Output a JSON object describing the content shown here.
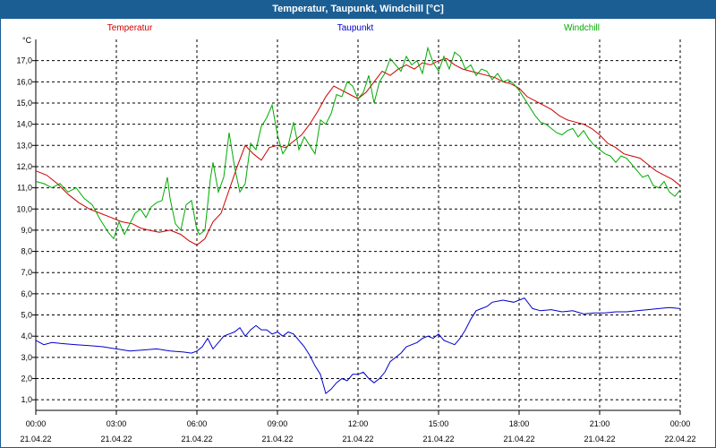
{
  "chart_data": {
    "type": "line",
    "title": "Temperatur, Taupunkt, Windchill [°C]",
    "yunit": "°C",
    "ylim": [
      0.5,
      18.0
    ],
    "yticks": [
      "1,0",
      "2,0",
      "3,0",
      "4,0",
      "5,0",
      "6,0",
      "7,0",
      "8,0",
      "9,0",
      "10,0",
      "11,0",
      "12,0",
      "13,0",
      "14,0",
      "15,0",
      "16,0",
      "17,0"
    ],
    "xlim": [
      0,
      24
    ],
    "xticks": [
      {
        "time": "00:00",
        "date": "21.04.22"
      },
      {
        "time": "03:00",
        "date": "21.04.22"
      },
      {
        "time": "06:00",
        "date": "21.04.22"
      },
      {
        "time": "09:00",
        "date": "21.04.22"
      },
      {
        "time": "12:00",
        "date": "21.04.22"
      },
      {
        "time": "15:00",
        "date": "21.04.22"
      },
      {
        "time": "18:00",
        "date": "21.04.22"
      },
      {
        "time": "21:00",
        "date": "21.04.22"
      },
      {
        "time": "00:00",
        "date": "22.04.22"
      }
    ],
    "grid": true,
    "legend_placement": "top",
    "series": [
      {
        "name": "Temperatur",
        "color": "#cc0000",
        "points": [
          [
            0,
            11.8
          ],
          [
            0.4,
            11.6
          ],
          [
            0.8,
            11.2
          ],
          [
            1.2,
            10.7
          ],
          [
            1.6,
            10.3
          ],
          [
            2.0,
            10.0
          ],
          [
            2.4,
            9.8
          ],
          [
            2.8,
            9.6
          ],
          [
            3.2,
            9.4
          ],
          [
            3.6,
            9.3
          ],
          [
            3.9,
            9.1
          ],
          [
            4.2,
            9.0
          ],
          [
            4.6,
            8.9
          ],
          [
            5.0,
            9.0
          ],
          [
            5.4,
            8.8
          ],
          [
            5.7,
            8.5
          ],
          [
            6.0,
            8.3
          ],
          [
            6.3,
            8.6
          ],
          [
            6.6,
            9.4
          ],
          [
            6.9,
            9.8
          ],
          [
            7.2,
            10.9
          ],
          [
            7.5,
            12.0
          ],
          [
            7.8,
            13.0
          ],
          [
            8.1,
            12.6
          ],
          [
            8.4,
            12.3
          ],
          [
            8.7,
            12.9
          ],
          [
            9.0,
            13.0
          ],
          [
            9.3,
            12.9
          ],
          [
            9.6,
            13.2
          ],
          [
            9.9,
            13.5
          ],
          [
            10.2,
            14.0
          ],
          [
            10.5,
            14.6
          ],
          [
            10.8,
            15.3
          ],
          [
            11.1,
            15.8
          ],
          [
            11.4,
            15.6
          ],
          [
            11.7,
            15.4
          ],
          [
            12.0,
            15.2
          ],
          [
            12.3,
            15.5
          ],
          [
            12.6,
            16.0
          ],
          [
            12.9,
            16.5
          ],
          [
            13.2,
            16.3
          ],
          [
            13.5,
            16.6
          ],
          [
            13.8,
            16.8
          ],
          [
            14.1,
            16.6
          ],
          [
            14.4,
            16.9
          ],
          [
            14.7,
            16.8
          ],
          [
            15.0,
            17.0
          ],
          [
            15.3,
            17.1
          ],
          [
            15.6,
            16.8
          ],
          [
            15.9,
            16.6
          ],
          [
            16.2,
            16.5
          ],
          [
            16.5,
            16.4
          ],
          [
            16.8,
            16.3
          ],
          [
            17.1,
            16.2
          ],
          [
            17.4,
            16.0
          ],
          [
            17.7,
            15.9
          ],
          [
            18.0,
            15.7
          ],
          [
            18.3,
            15.3
          ],
          [
            18.6,
            15.1
          ],
          [
            18.9,
            14.9
          ],
          [
            19.2,
            14.7
          ],
          [
            19.5,
            14.4
          ],
          [
            19.8,
            14.2
          ],
          [
            20.1,
            14.1
          ],
          [
            20.4,
            14.0
          ],
          [
            20.7,
            13.8
          ],
          [
            21.0,
            13.5
          ],
          [
            21.3,
            13.1
          ],
          [
            21.6,
            12.9
          ],
          [
            21.9,
            12.6
          ],
          [
            22.2,
            12.5
          ],
          [
            22.5,
            12.4
          ],
          [
            22.8,
            12.1
          ],
          [
            23.1,
            11.8
          ],
          [
            23.4,
            11.6
          ],
          [
            23.7,
            11.4
          ],
          [
            24.0,
            11.1
          ]
        ]
      },
      {
        "name": "Taupunkt",
        "color": "#0000cc",
        "points": [
          [
            0,
            3.8
          ],
          [
            0.3,
            3.6
          ],
          [
            0.6,
            3.7
          ],
          [
            1.0,
            3.65
          ],
          [
            1.5,
            3.6
          ],
          [
            2.0,
            3.55
          ],
          [
            2.5,
            3.5
          ],
          [
            3.0,
            3.4
          ],
          [
            3.5,
            3.3
          ],
          [
            4.0,
            3.35
          ],
          [
            4.5,
            3.4
          ],
          [
            5.0,
            3.3
          ],
          [
            5.5,
            3.25
          ],
          [
            5.8,
            3.2
          ],
          [
            6.0,
            3.3
          ],
          [
            6.2,
            3.5
          ],
          [
            6.4,
            3.9
          ],
          [
            6.6,
            3.4
          ],
          [
            6.8,
            3.7
          ],
          [
            7.0,
            4.0
          ],
          [
            7.2,
            4.1
          ],
          [
            7.4,
            4.2
          ],
          [
            7.6,
            4.4
          ],
          [
            7.8,
            4.0
          ],
          [
            8.0,
            4.3
          ],
          [
            8.2,
            4.5
          ],
          [
            8.4,
            4.3
          ],
          [
            8.6,
            4.3
          ],
          [
            8.8,
            4.1
          ],
          [
            9.0,
            4.2
          ],
          [
            9.2,
            4.0
          ],
          [
            9.4,
            4.2
          ],
          [
            9.6,
            4.1
          ],
          [
            9.8,
            3.8
          ],
          [
            10.0,
            3.5
          ],
          [
            10.2,
            3.1
          ],
          [
            10.4,
            2.6
          ],
          [
            10.6,
            2.2
          ],
          [
            10.8,
            1.3
          ],
          [
            11.0,
            1.5
          ],
          [
            11.2,
            1.8
          ],
          [
            11.4,
            2.0
          ],
          [
            11.6,
            1.9
          ],
          [
            11.8,
            2.2
          ],
          [
            12.0,
            2.2
          ],
          [
            12.2,
            2.3
          ],
          [
            12.4,
            2.0
          ],
          [
            12.6,
            1.8
          ],
          [
            12.8,
            2.0
          ],
          [
            13.0,
            2.3
          ],
          [
            13.2,
            2.8
          ],
          [
            13.4,
            3.0
          ],
          [
            13.6,
            3.2
          ],
          [
            13.8,
            3.5
          ],
          [
            14.0,
            3.6
          ],
          [
            14.2,
            3.7
          ],
          [
            14.4,
            3.9
          ],
          [
            14.6,
            4.0
          ],
          [
            14.8,
            3.9
          ],
          [
            15.0,
            4.1
          ],
          [
            15.2,
            3.8
          ],
          [
            15.4,
            3.7
          ],
          [
            15.6,
            3.6
          ],
          [
            15.8,
            3.9
          ],
          [
            16.0,
            4.3
          ],
          [
            16.2,
            4.8
          ],
          [
            16.4,
            5.2
          ],
          [
            16.6,
            5.3
          ],
          [
            16.8,
            5.4
          ],
          [
            17.0,
            5.6
          ],
          [
            17.4,
            5.7
          ],
          [
            17.8,
            5.6
          ],
          [
            18.2,
            5.8
          ],
          [
            18.5,
            5.3
          ],
          [
            18.8,
            5.2
          ],
          [
            19.2,
            5.25
          ],
          [
            19.6,
            5.15
          ],
          [
            20.0,
            5.2
          ],
          [
            20.4,
            5.05
          ],
          [
            20.8,
            5.1
          ],
          [
            21.2,
            5.1
          ],
          [
            21.6,
            5.15
          ],
          [
            22.0,
            5.15
          ],
          [
            22.4,
            5.2
          ],
          [
            22.8,
            5.25
          ],
          [
            23.2,
            5.3
          ],
          [
            23.6,
            5.35
          ],
          [
            24.0,
            5.3
          ]
        ]
      },
      {
        "name": "Windchill",
        "color": "#00aa00",
        "points": [
          [
            0,
            11.3
          ],
          [
            0.3,
            11.2
          ],
          [
            0.6,
            11.0
          ],
          [
            0.9,
            11.2
          ],
          [
            1.2,
            10.8
          ],
          [
            1.5,
            11.0
          ],
          [
            1.8,
            10.5
          ],
          [
            2.1,
            10.2
          ],
          [
            2.4,
            9.5
          ],
          [
            2.7,
            8.9
          ],
          [
            2.9,
            8.6
          ],
          [
            3.1,
            9.4
          ],
          [
            3.3,
            8.8
          ],
          [
            3.5,
            9.3
          ],
          [
            3.7,
            9.8
          ],
          [
            3.9,
            10.0
          ],
          [
            4.1,
            9.6
          ],
          [
            4.3,
            10.1
          ],
          [
            4.5,
            10.3
          ],
          [
            4.7,
            10.4
          ],
          [
            4.9,
            11.5
          ],
          [
            5.0,
            10.5
          ],
          [
            5.2,
            9.3
          ],
          [
            5.4,
            9.0
          ],
          [
            5.6,
            10.2
          ],
          [
            5.8,
            10.4
          ],
          [
            6.0,
            9.0
          ],
          [
            6.1,
            8.8
          ],
          [
            6.3,
            9.0
          ],
          [
            6.5,
            11.4
          ],
          [
            6.6,
            12.2
          ],
          [
            6.8,
            10.8
          ],
          [
            7.0,
            11.5
          ],
          [
            7.2,
            13.6
          ],
          [
            7.4,
            12.0
          ],
          [
            7.6,
            10.8
          ],
          [
            7.8,
            11.2
          ],
          [
            8.0,
            13.1
          ],
          [
            8.2,
            12.8
          ],
          [
            8.4,
            13.9
          ],
          [
            8.6,
            14.3
          ],
          [
            8.8,
            14.9
          ],
          [
            9.0,
            13.5
          ],
          [
            9.2,
            12.6
          ],
          [
            9.4,
            13.0
          ],
          [
            9.6,
            14.1
          ],
          [
            9.8,
            12.8
          ],
          [
            10.0,
            13.4
          ],
          [
            10.2,
            13.0
          ],
          [
            10.4,
            12.6
          ],
          [
            10.6,
            14.2
          ],
          [
            10.8,
            14.0
          ],
          [
            11.0,
            14.5
          ],
          [
            11.2,
            15.4
          ],
          [
            11.4,
            15.3
          ],
          [
            11.6,
            16.0
          ],
          [
            11.8,
            15.8
          ],
          [
            12.0,
            15.2
          ],
          [
            12.2,
            15.5
          ],
          [
            12.4,
            16.3
          ],
          [
            12.6,
            15.0
          ],
          [
            12.8,
            16.0
          ],
          [
            13.0,
            16.4
          ],
          [
            13.2,
            17.1
          ],
          [
            13.4,
            16.8
          ],
          [
            13.6,
            16.5
          ],
          [
            13.8,
            17.2
          ],
          [
            14.0,
            16.8
          ],
          [
            14.2,
            17.0
          ],
          [
            14.4,
            16.4
          ],
          [
            14.6,
            17.6
          ],
          [
            14.8,
            16.9
          ],
          [
            15.0,
            16.5
          ],
          [
            15.2,
            17.2
          ],
          [
            15.4,
            16.6
          ],
          [
            15.6,
            17.4
          ],
          [
            15.8,
            17.2
          ],
          [
            16.0,
            16.6
          ],
          [
            16.2,
            16.8
          ],
          [
            16.4,
            16.3
          ],
          [
            16.6,
            16.6
          ],
          [
            16.8,
            16.5
          ],
          [
            17.0,
            16.1
          ],
          [
            17.2,
            16.4
          ],
          [
            17.4,
            16.0
          ],
          [
            17.6,
            16.1
          ],
          [
            17.8,
            15.9
          ],
          [
            18.0,
            15.6
          ],
          [
            18.2,
            15.2
          ],
          [
            18.4,
            14.8
          ],
          [
            18.6,
            14.4
          ],
          [
            18.8,
            14.1
          ],
          [
            19.0,
            14.0
          ],
          [
            19.2,
            13.8
          ],
          [
            19.4,
            13.6
          ],
          [
            19.6,
            13.5
          ],
          [
            19.8,
            13.7
          ],
          [
            20.0,
            13.8
          ],
          [
            20.2,
            13.4
          ],
          [
            20.4,
            13.7
          ],
          [
            20.6,
            13.3
          ],
          [
            20.8,
            13.0
          ],
          [
            21.0,
            12.8
          ],
          [
            21.2,
            12.6
          ],
          [
            21.4,
            12.5
          ],
          [
            21.6,
            12.2
          ],
          [
            21.8,
            12.5
          ],
          [
            22.0,
            12.4
          ],
          [
            22.2,
            12.1
          ],
          [
            22.4,
            11.8
          ],
          [
            22.6,
            11.5
          ],
          [
            22.8,
            11.6
          ],
          [
            23.0,
            11.1
          ],
          [
            23.2,
            11.0
          ],
          [
            23.4,
            11.3
          ],
          [
            23.6,
            10.8
          ],
          [
            23.8,
            10.6
          ],
          [
            24.0,
            10.9
          ]
        ]
      }
    ]
  }
}
